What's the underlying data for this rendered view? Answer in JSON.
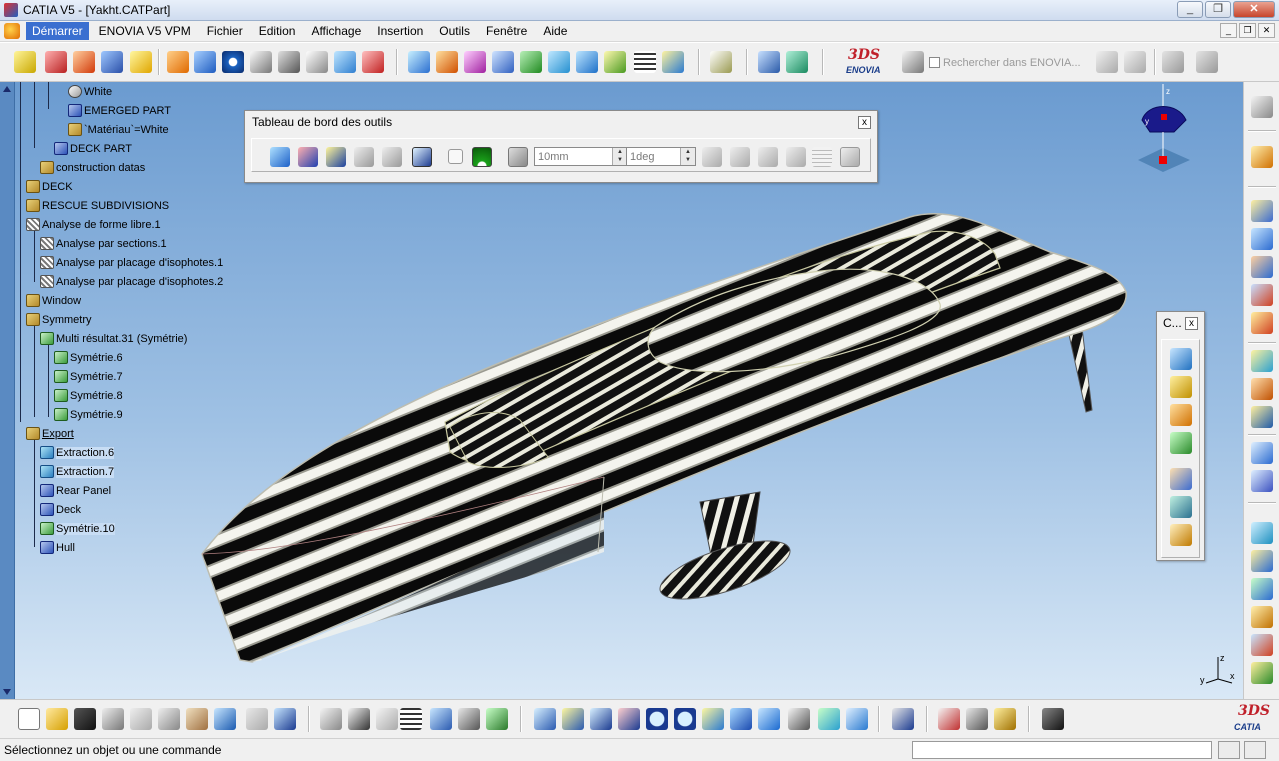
{
  "window": {
    "title": "CATIA V5 - [Yakht.CATPart]",
    "minimize": "_",
    "restore": "❐",
    "close": "✕"
  },
  "menubar": {
    "items": [
      {
        "label": "Démarrer",
        "active": true
      },
      {
        "label": "ENOVIA V5 VPM",
        "active": false
      },
      {
        "label": "Fichier",
        "active": false
      },
      {
        "label": "Edition",
        "active": false
      },
      {
        "label": "Affichage",
        "active": false
      },
      {
        "label": "Insertion",
        "active": false
      },
      {
        "label": "Outils",
        "active": false
      },
      {
        "label": "Fenêtre",
        "active": false
      },
      {
        "label": "Aide",
        "active": false
      }
    ],
    "doc_controls": [
      "_",
      "❐",
      "✕"
    ]
  },
  "top_toolbar": {
    "search_placeholder": "Rechercher dans ENOVIA...",
    "enovia_logo_ds": "3DS",
    "enovia_logo_name": "ENOVIA"
  },
  "tree": {
    "nodes": [
      {
        "label": "White",
        "icon": "material-sphere-icon",
        "highlight": false,
        "underline": false
      },
      {
        "label": "EMERGED PART",
        "icon": "geometrical-set-icon",
        "highlight": false,
        "underline": false
      },
      {
        "label": "`Matériau`=White",
        "icon": "parameter-icon",
        "highlight": false,
        "underline": false
      },
      {
        "label": "DECK PART",
        "icon": "geometrical-set-icon",
        "highlight": false,
        "underline": false
      },
      {
        "label": "construction datas",
        "icon": "body-icon",
        "highlight": false,
        "underline": false
      },
      {
        "label": "DECK",
        "icon": "body-icon",
        "highlight": false,
        "underline": false
      },
      {
        "label": "RESCUE SUBDIVISIONS",
        "icon": "body-icon",
        "highlight": false,
        "underline": false
      },
      {
        "label": "Analyse de forme libre.1",
        "icon": "analysis-icon",
        "highlight": false,
        "underline": false
      },
      {
        "label": "Analyse par sections.1",
        "icon": "analysis-icon",
        "highlight": false,
        "underline": false
      },
      {
        "label": "Analyse par placage d'isophotes.1",
        "icon": "analysis-icon",
        "highlight": false,
        "underline": false
      },
      {
        "label": "Analyse par placage d'isophotes.2",
        "icon": "analysis-icon",
        "highlight": false,
        "underline": false
      },
      {
        "label": "Window",
        "icon": "body-icon",
        "highlight": false,
        "underline": false
      },
      {
        "label": "Symmetry",
        "icon": "body-icon",
        "highlight": false,
        "underline": false
      },
      {
        "label": "Multi résultat.31 (Symétrie)",
        "icon": "symmetry-icon",
        "highlight": false,
        "underline": false
      },
      {
        "label": "Symétrie.6",
        "icon": "symmetry-icon",
        "highlight": false,
        "underline": false
      },
      {
        "label": "Symétrie.7",
        "icon": "symmetry-icon",
        "highlight": false,
        "underline": false
      },
      {
        "label": "Symétrie.8",
        "icon": "symmetry-icon",
        "highlight": false,
        "underline": false
      },
      {
        "label": "Symétrie.9",
        "icon": "symmetry-icon",
        "highlight": false,
        "underline": false
      },
      {
        "label": "Export",
        "icon": "body-icon",
        "highlight": false,
        "underline": true
      },
      {
        "label": "Extraction.6",
        "icon": "surface-icon",
        "highlight": true,
        "underline": false
      },
      {
        "label": "Extraction.7",
        "icon": "surface-icon",
        "highlight": true,
        "underline": false
      },
      {
        "label": "Rear Panel",
        "icon": "geometrical-set-icon",
        "highlight": false,
        "underline": false
      },
      {
        "label": "Deck",
        "icon": "geometrical-set-icon",
        "highlight": false,
        "underline": false
      },
      {
        "label": "Symétrie.10",
        "icon": "symmetry-icon",
        "highlight": true,
        "underline": false
      },
      {
        "label": "Hull",
        "icon": "geometrical-set-icon",
        "highlight": false,
        "underline": false
      }
    ]
  },
  "dashboard": {
    "title": "Tableau de bord des outils",
    "close": "x",
    "grid_value": "10mm",
    "angle_value": "1deg"
  },
  "float_c": {
    "title": "C...",
    "close": "x"
  },
  "axis": {
    "x": "x",
    "y": "y",
    "z": "z"
  },
  "bottom_toolbar": {
    "logo_ds": "3DS",
    "logo_name": "CATIA"
  },
  "statusbar": {
    "message": "Sélectionnez un objet ou une commande",
    "command_value": ""
  }
}
